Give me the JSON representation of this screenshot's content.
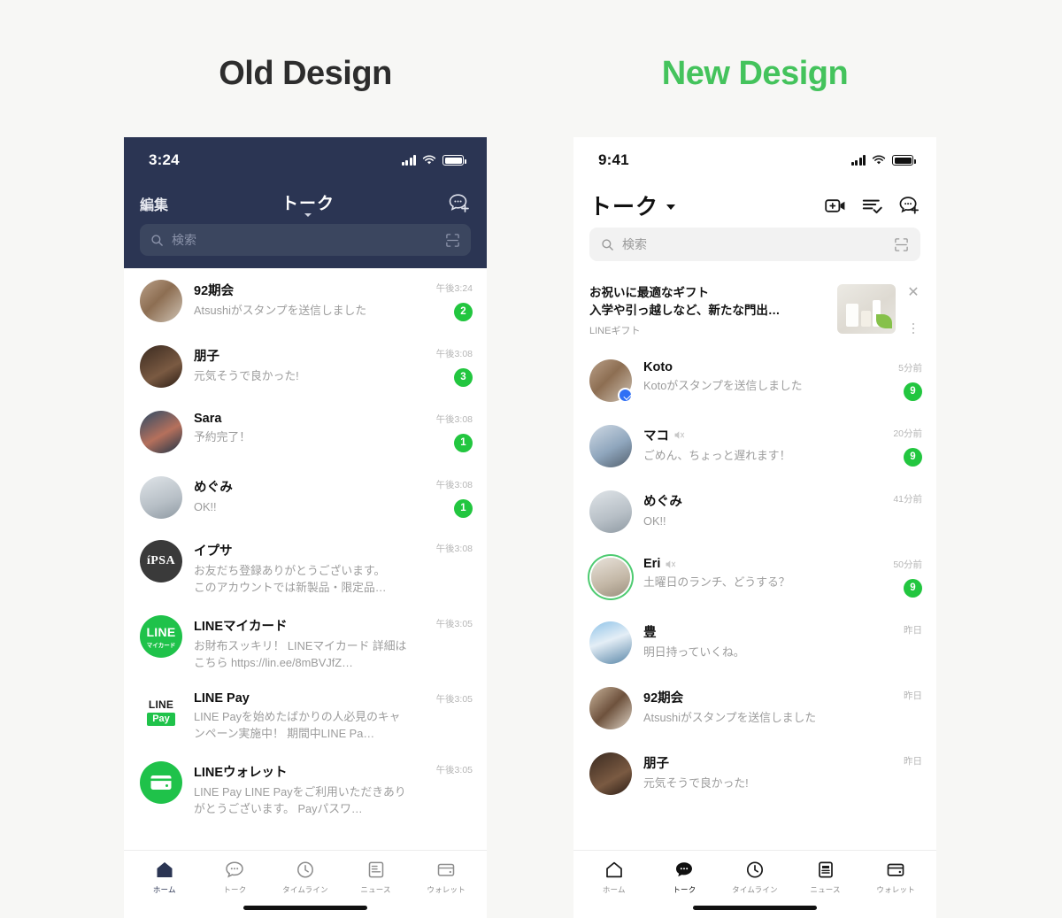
{
  "page": {
    "background": "#f7f7f5",
    "old_title": "Old Design",
    "new_title": "New Design",
    "old_title_color": "#2d2d2d",
    "new_title_color": "#44c35c",
    "accent_green": "#22c63f",
    "old_header_navy": "#2b3553"
  },
  "old": {
    "status": {
      "time": "3:24"
    },
    "header": {
      "edit_label": "編集",
      "title": "トーク",
      "compose_icon": "chat-add-icon"
    },
    "search": {
      "placeholder": "検索",
      "icon": "search-icon",
      "qr_icon": "qr-scan-icon"
    },
    "chats": [
      {
        "name": "92期会",
        "message": "Atsushiがスタンプを送信しました",
        "time": "午後3:24",
        "badge": "2",
        "avatar": "group-photo"
      },
      {
        "name": "朋子",
        "message": "元気そうで良かった!",
        "time": "午後3:08",
        "badge": "3",
        "avatar": "person-photo"
      },
      {
        "name": "Sara",
        "message": "予約完了！",
        "time": "午後3:08",
        "badge": "1",
        "avatar": "person-photo"
      },
      {
        "name": "めぐみ",
        "message": "OK!!",
        "time": "午後3:08",
        "badge": "1",
        "avatar": "person-photo"
      },
      {
        "name": "イプサ",
        "message": "お友だち登録ありがとうございます。\nこのアカウントでは新製品・限定品…",
        "time": "午後3:08",
        "badge": "",
        "avatar": "ipsa-logo"
      },
      {
        "name": "LINEマイカード",
        "message": "お財布スッキリ！ LINEマイカード 詳細はこちら https://lin.ee/8mBVJfZ…",
        "time": "午後3:05",
        "badge": "",
        "avatar": "line-mycard-logo"
      },
      {
        "name": "LINE Pay",
        "message": "LINE Payを始めたばかりの人必見のキャンペーン実施中！ 期間中LINE Pa…",
        "time": "午後3:05",
        "badge": "",
        "avatar": "line-pay-logo"
      },
      {
        "name": "LINEウォレット",
        "message": "LINE Pay LINE Payをご利用いただきありがとうございます。 Payパスワ…",
        "time": "午後3:05",
        "badge": "",
        "avatar": "line-wallet-logo"
      }
    ],
    "tabs": [
      {
        "label": "ホーム",
        "icon": "home-icon",
        "active": true
      },
      {
        "label": "トーク",
        "icon": "chat-icon",
        "active": false
      },
      {
        "label": "タイムライン",
        "icon": "clock-icon",
        "active": false
      },
      {
        "label": "ニュース",
        "icon": "news-icon",
        "active": false
      },
      {
        "label": "ウォレット",
        "icon": "wallet-icon",
        "active": false
      }
    ]
  },
  "new": {
    "status": {
      "time": "9:41"
    },
    "header": {
      "title": "トーク",
      "icons": [
        "video-add-icon",
        "mark-read-icon",
        "chat-add-icon"
      ]
    },
    "search": {
      "placeholder": "検索",
      "icon": "search-icon",
      "qr_icon": "qr-scan-icon"
    },
    "promo": {
      "line1": "お祝いに最適なギフト",
      "line2": "入学や引っ越しなど、新たな門出…",
      "source": "LINEギフト",
      "close_icon": "close-icon",
      "more_icon": "more-vertical-icon"
    },
    "chats": [
      {
        "name": "Koto",
        "message": "Kotoがスタンプを送信しました",
        "time": "5分前",
        "badge": "9",
        "avatar": "person-photo",
        "mute": false,
        "ring": false,
        "sub_badge": true
      },
      {
        "name": "マコ",
        "message": "ごめん、ちょっと遅れます！",
        "time": "20分前",
        "badge": "9",
        "avatar": "person-photo",
        "mute": true,
        "ring": false,
        "sub_badge": false
      },
      {
        "name": "めぐみ",
        "message": "OK!!",
        "time": "41分前",
        "badge": "",
        "avatar": "person-photo",
        "mute": false,
        "ring": false,
        "sub_badge": false
      },
      {
        "name": "Eri",
        "message": "土曜日のランチ、どうする？",
        "time": "50分前",
        "badge": "9",
        "avatar": "person-photo",
        "mute": true,
        "ring": true,
        "sub_badge": false
      },
      {
        "name": "豊",
        "message": "明日持っていくね。",
        "time": "昨日",
        "badge": "",
        "avatar": "landscape-photo",
        "mute": false,
        "ring": false,
        "sub_badge": false
      },
      {
        "name": "92期会",
        "message": "Atsushiがスタンプを送信しました",
        "time": "昨日",
        "badge": "",
        "avatar": "group-photo",
        "mute": false,
        "ring": false,
        "sub_badge": false
      },
      {
        "name": "朋子",
        "message": "元気そうで良かった!",
        "time": "昨日",
        "badge": "",
        "avatar": "person-photo",
        "mute": false,
        "ring": false,
        "sub_badge": false
      }
    ],
    "tabs": [
      {
        "label": "ホーム",
        "icon": "home-icon",
        "active": false
      },
      {
        "label": "トーク",
        "icon": "chat-icon",
        "active": true
      },
      {
        "label": "タイムライン",
        "icon": "clock-icon",
        "active": false
      },
      {
        "label": "ニュース",
        "icon": "news-icon",
        "active": false
      },
      {
        "label": "ウォレット",
        "icon": "wallet-icon",
        "active": false
      }
    ]
  }
}
